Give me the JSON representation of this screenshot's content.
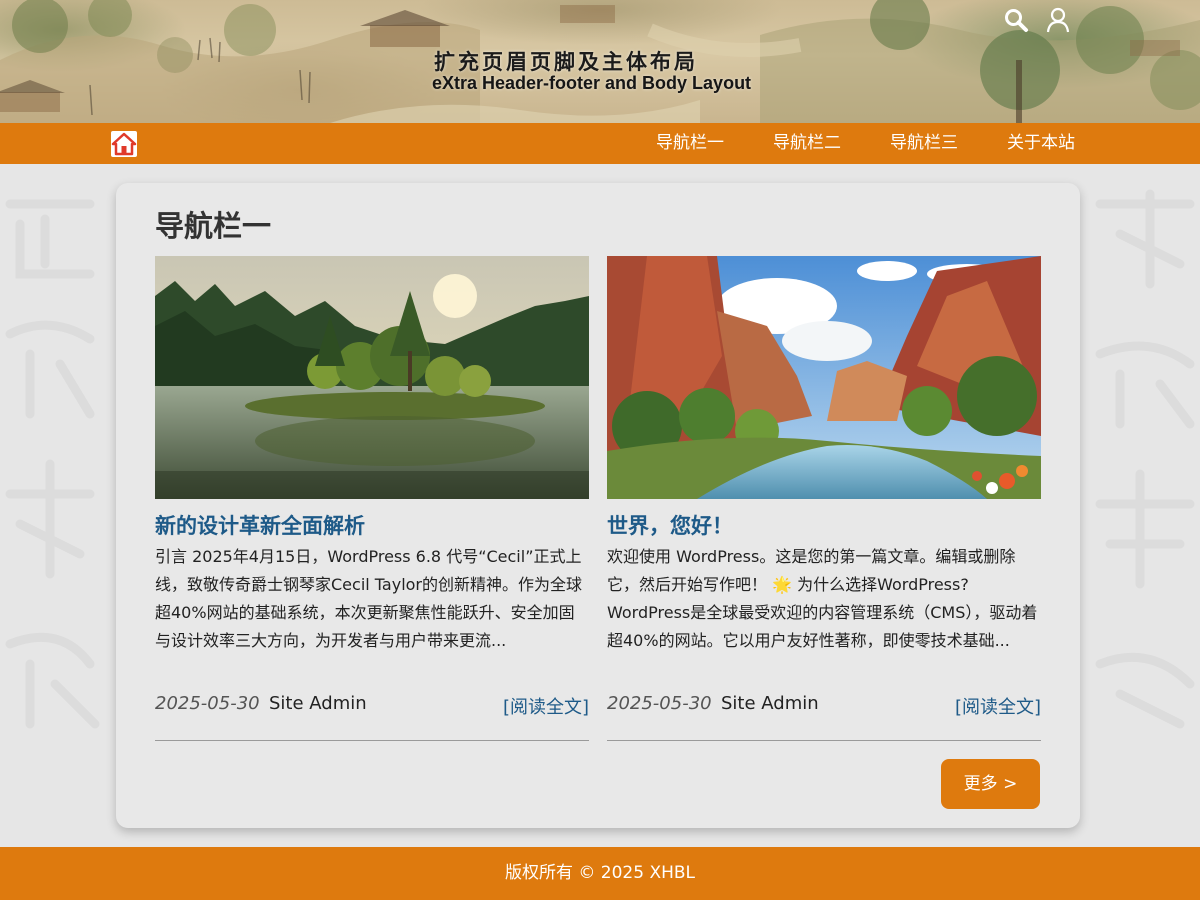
{
  "header": {
    "title_cn": "扩充页眉页脚及主体布局",
    "title_en": "eXtra Header-footer and Body Layout",
    "icons": [
      "search-icon",
      "user-icon"
    ]
  },
  "nav": {
    "home_icon": "home-icon",
    "items": [
      "导航栏一",
      "导航栏二",
      "导航栏三",
      "关于本站"
    ]
  },
  "main": {
    "page_title": "导航栏一",
    "posts": [
      {
        "image": "lake-island-landscape",
        "title": "新的设计革新全面解析",
        "excerpt": "引言 2025年4月15日，WordPress 6.8 代号“Cecil”正式上线，致敬传奇爵士钢琴家Cecil Taylor的创新精神。作为全球超40%网站的基础系统，本次更新聚焦性能跃升、安全加固与设计效率三大方向，为开发者与用户带来更流...",
        "date": "2025-05-30",
        "author": "Site Admin",
        "read_more": "[阅读全文]"
      },
      {
        "image": "canyon-river-landscape",
        "title": "世界，您好！",
        "excerpt": "欢迎使用 WordPress。这是您的第一篇文章。编辑或删除它，然后开始写作吧！ 🌟 为什么选择WordPress? WordPress是全球最受欢迎的内容管理系统（CMS），驱动着超40%的网站。它以用户友好性著称，即使零技术基础...",
        "date": "2025-05-30",
        "author": "Site Admin",
        "read_more": "[阅读全文]"
      }
    ],
    "more_button": "更多 >"
  },
  "footer": {
    "copyright": "版权所有 © 2025 XHBL"
  },
  "colors": {
    "accent": "#de7a0e",
    "link": "#1e5a88",
    "background": "#e6e6e6"
  }
}
